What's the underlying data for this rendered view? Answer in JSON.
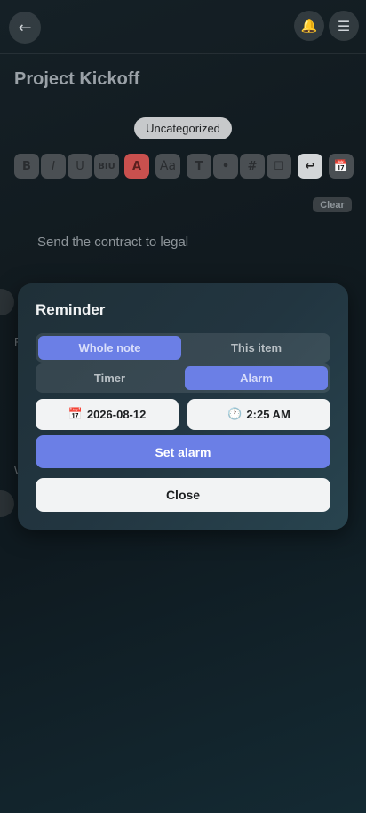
{
  "header": {
    "back_icon": "←",
    "bell_icon": "🔔",
    "menu_icon": "☰"
  },
  "note": {
    "title": "Project Kickoff",
    "category": "Uncategorized",
    "clear_label": "Clear",
    "line1": "Send the contract to legal"
  },
  "toolbar": {
    "bold": "B",
    "italic": "I",
    "underline": "U",
    "biu": "BIU",
    "color": "A",
    "size": "Aa",
    "text": "T",
    "bullet": "•",
    "number": "#",
    "checkbox": "☐",
    "undo": "↩",
    "calendar": "📅"
  },
  "ghost": {
    "p": "P",
    "w": "W"
  },
  "reminder": {
    "title": "Reminder",
    "scope_options": [
      "Whole note",
      "This item"
    ],
    "scope_selected": "Whole note",
    "mode_options": [
      "Timer",
      "Alarm"
    ],
    "mode_selected": "Alarm",
    "date_icon": "📅",
    "date": "2026-08-12",
    "time_icon": "🕐",
    "time": "2:25 AM",
    "set_label": "Set alarm",
    "close_label": "Close"
  },
  "colors": {
    "accent": "#6b7fe6",
    "panel": "#223540"
  }
}
